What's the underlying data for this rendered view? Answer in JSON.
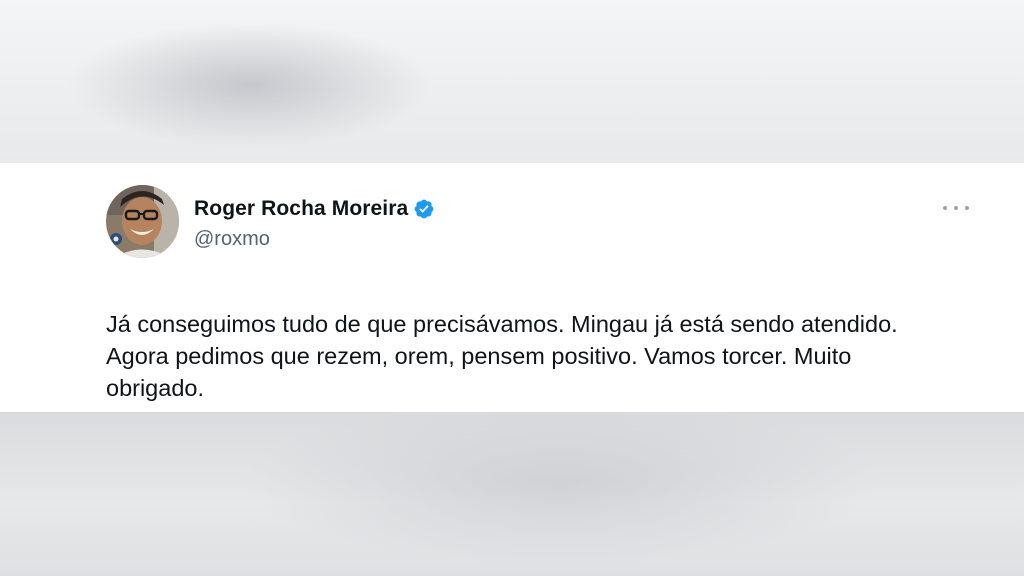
{
  "tweet": {
    "author": {
      "display_name": "Roger Rocha Moreira",
      "handle": "@roxmo",
      "verified": true,
      "verified_color": "#1d9bf0"
    },
    "text": "Já conseguimos tudo de que precisávamos. Mingau já está sendo atendido. Agora pedimos que rezem, orem, pensem positivo. Vamos torcer. Muito obrigado.",
    "icons": {
      "avatar": "avatar-photo",
      "verified": "verified-badge-icon",
      "more": "more-options-icon"
    }
  },
  "colors": {
    "text_primary": "#0f1419",
    "text_secondary": "#536471",
    "card_background": "#ffffff"
  }
}
